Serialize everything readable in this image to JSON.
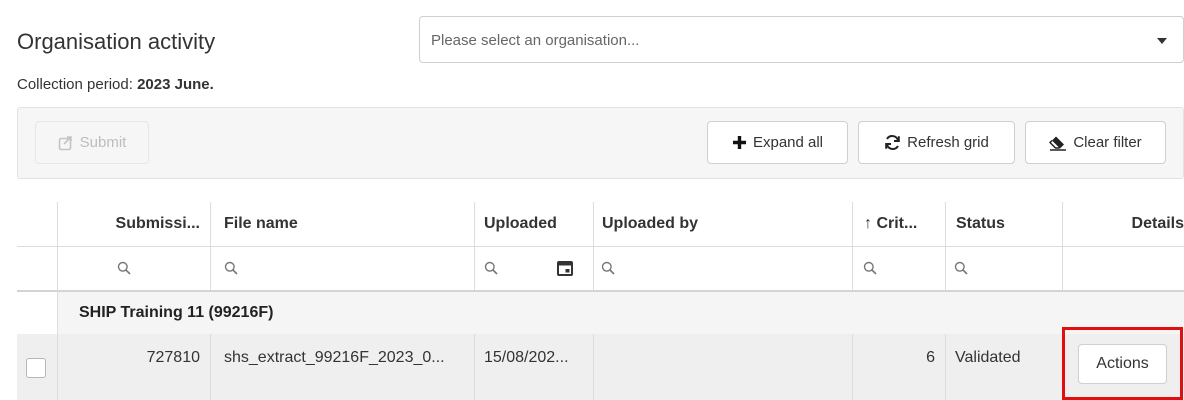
{
  "header": {
    "title": "Organisation activity",
    "period_label": "Collection period:",
    "period_value": "2023 June."
  },
  "org_select": {
    "placeholder": "Please select an organisation..."
  },
  "toolbar": {
    "submit_label": "Submit",
    "expand_label": "Expand all",
    "refresh_label": "Refresh grid",
    "clear_label": "Clear filter"
  },
  "grid": {
    "columns": [
      "Submissi...",
      "File name",
      "Uploaded",
      "Uploaded by",
      "↑ Crit...",
      "Status",
      "Details"
    ],
    "group": "SHIP Training 11  (99216F)",
    "row": {
      "submission": "727810",
      "file_name": "shs_extract_99216F_2023_0...",
      "uploaded": "15/08/202...",
      "uploaded_by": "",
      "crit": "6",
      "status": "Validated",
      "details_button": "Actions"
    }
  },
  "colors": {
    "highlight": "#e01010",
    "toolbar_bg": "#f6f6f6",
    "row_bg": "#efefef"
  }
}
